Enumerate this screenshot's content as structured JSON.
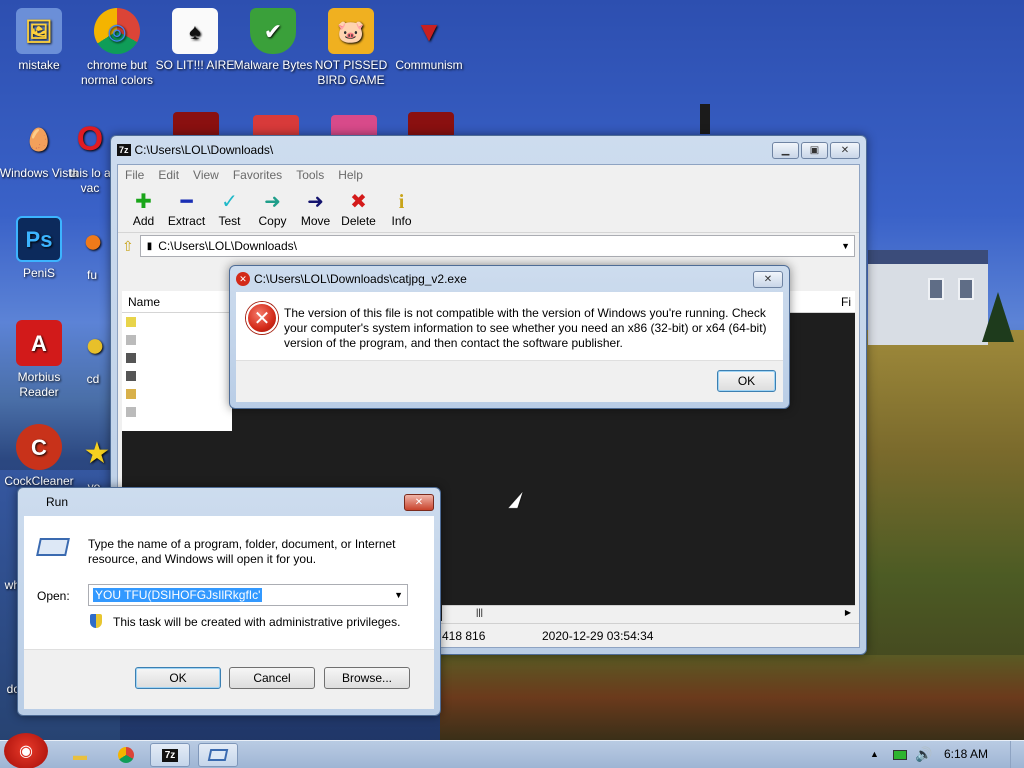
{
  "desktop": {
    "icons": [
      {
        "label": "mistake",
        "glyph": "🖼"
      },
      {
        "label": "chrome but normal colors",
        "glyph": "◎"
      },
      {
        "label": "SO LIT!!! AIRE",
        "glyph": "♠"
      },
      {
        "label": "Malware Bytes",
        "glyph": "✔"
      },
      {
        "label": "NOT PISSED BIRD GAME",
        "glyph": "🐷"
      },
      {
        "label": "Communism",
        "glyph": "▼"
      },
      {
        "label": "Windows Vista",
        "glyph": "🥚"
      },
      {
        "label": "this lo a vac",
        "glyph": "O"
      },
      {
        "label": "PeniS",
        "glyph": "Ps"
      },
      {
        "label": "fu",
        "glyph": "●"
      },
      {
        "label": "Morbius Reader",
        "glyph": "A"
      },
      {
        "label": "cd",
        "glyph": "●"
      },
      {
        "label": "CockCleaner",
        "glyph": "C"
      },
      {
        "label": "yo",
        "glyph": "★"
      },
      {
        "label": "wh",
        "glyph": ""
      },
      {
        "label": "do",
        "glyph": ""
      }
    ]
  },
  "sevenzip": {
    "title": "C:\\Users\\LOL\\Downloads\\",
    "title_icon": "7z",
    "menu": [
      "File",
      "Edit",
      "View",
      "Favorites",
      "Tools",
      "Help"
    ],
    "toolbar": [
      {
        "label": "Add",
        "icon": "✚",
        "color": "#1aa51a"
      },
      {
        "label": "Extract",
        "icon": "━",
        "color": "#1a2fb5"
      },
      {
        "label": "Test",
        "icon": "✓",
        "color": "#1fb8c8"
      },
      {
        "label": "Copy",
        "icon": "➜",
        "color": "#1f9e8a"
      },
      {
        "label": "Move",
        "icon": "➜",
        "color": "#14146e"
      },
      {
        "label": "Delete",
        "icon": "✖",
        "color": "#d41a1a"
      },
      {
        "label": "Info",
        "icon": "i",
        "color": "#c8a41a"
      }
    ],
    "address": "C:\\Users\\LOL\\Downloads\\",
    "columns": {
      "name": "Name",
      "right": "Fi"
    },
    "status": {
      "size": "418 816",
      "date": "2020-12-29 03:54:34"
    }
  },
  "error_dialog": {
    "title": "C:\\Users\\LOL\\Downloads\\catjpg_v2.exe",
    "message": "The version of this file is not compatible with the version of Windows you're running. Check your computer's system information to see whether you need an x86 (32-bit) or x64 (64-bit) version of the program, and then contact the software publisher.",
    "ok_label": "OK"
  },
  "run_dialog": {
    "title": "Run",
    "description": "Type the name of a program, folder, document, or Internet resource, and Windows will open it for you.",
    "open_label": "Open:",
    "open_value": "YOU TFU(DSIHOFGJsIlRkgfIc'",
    "admin_note": "This task will be created with administrative privileges.",
    "ok_label": "OK",
    "cancel_label": "Cancel",
    "browse_label": "Browse..."
  },
  "taskbar": {
    "clock": "6:18 AM"
  }
}
